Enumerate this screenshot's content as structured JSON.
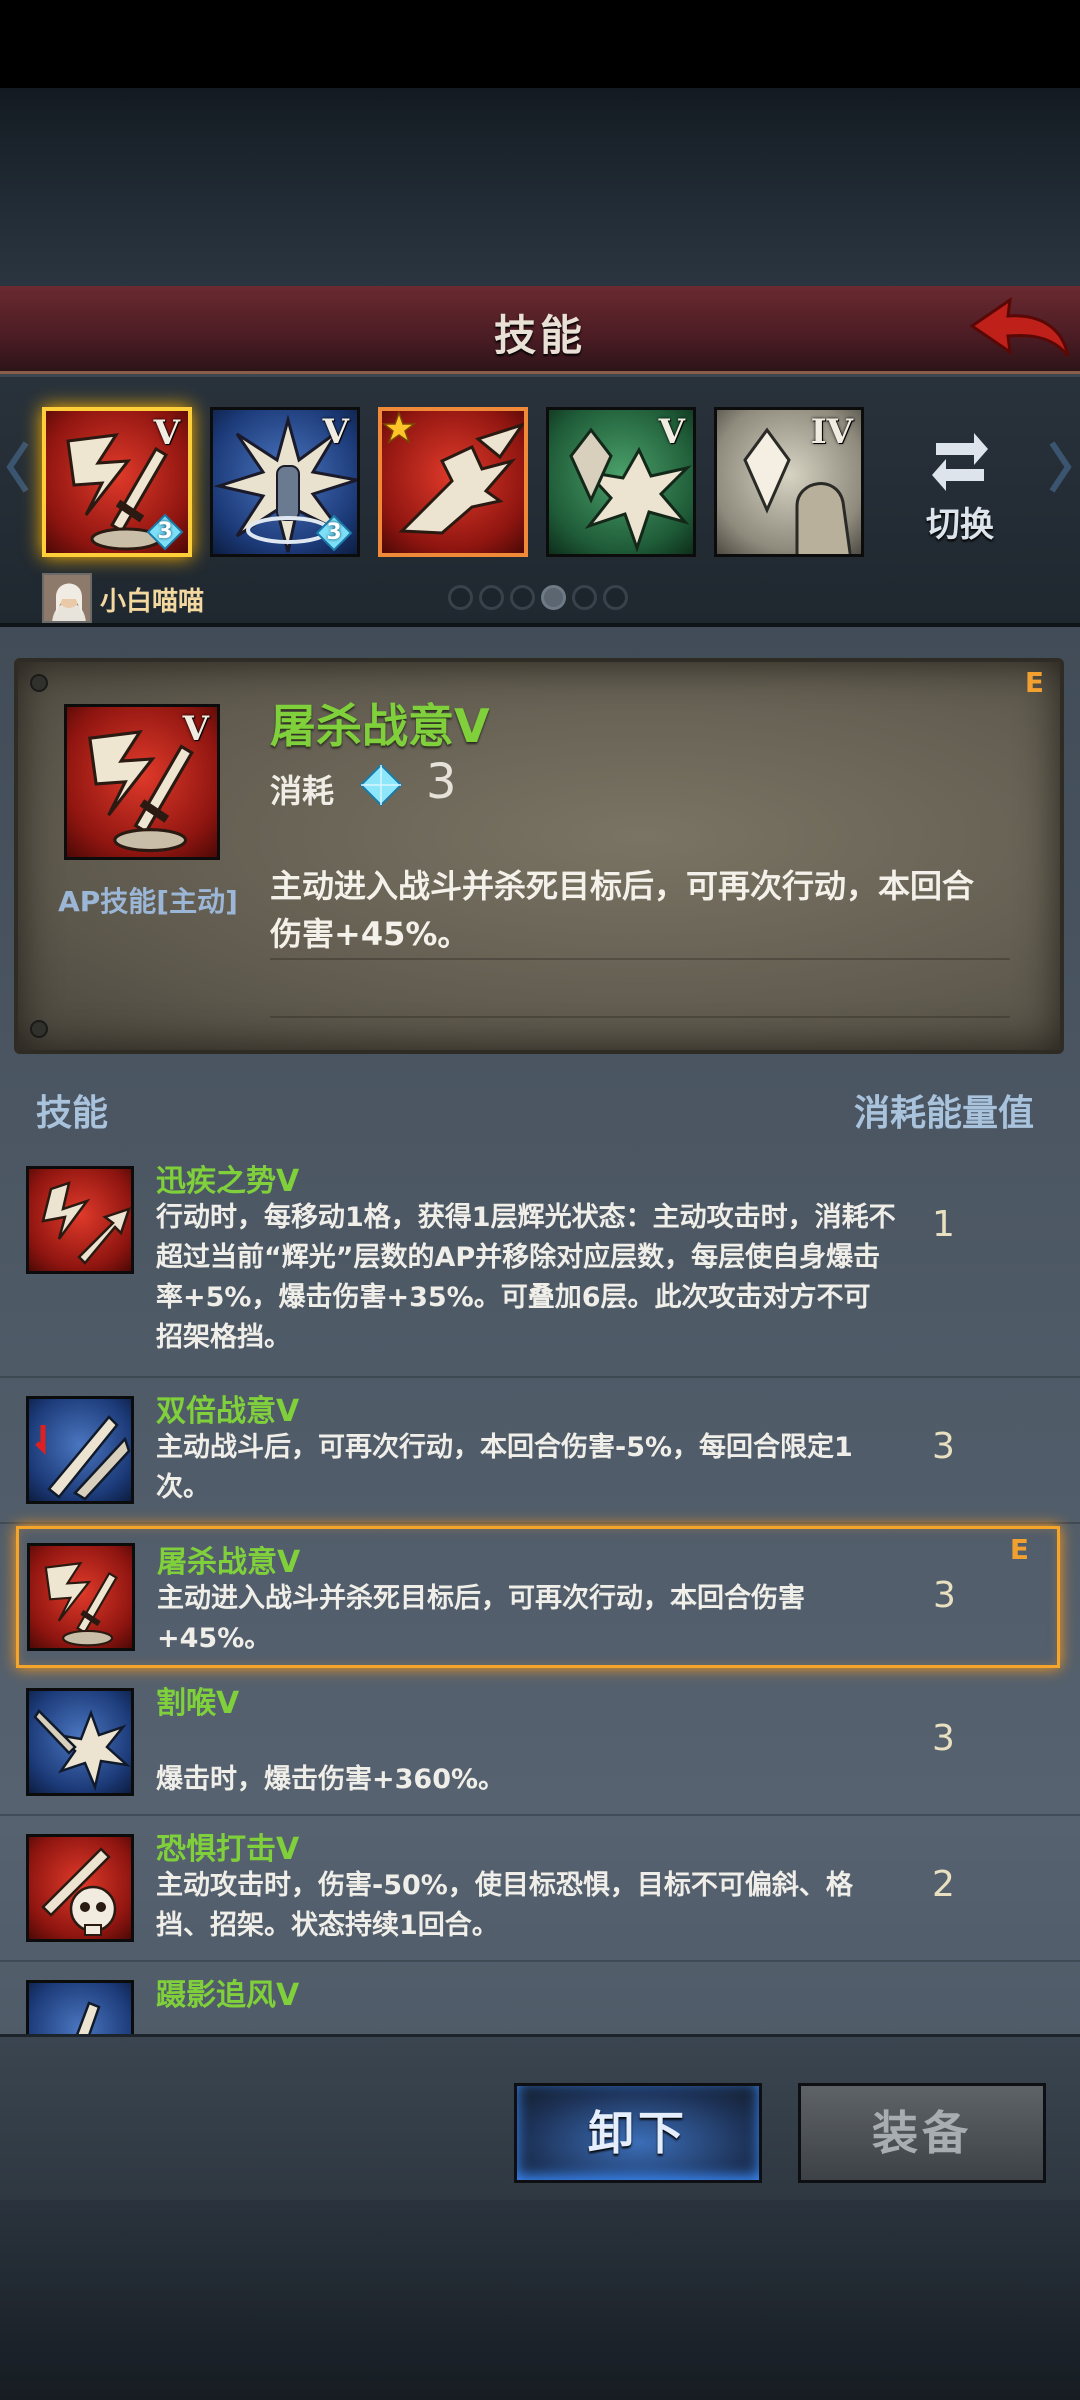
{
  "header": {
    "title": "技能"
  },
  "skillbar": {
    "slots": [
      {
        "tier": "V",
        "cost": "3",
        "color": "red",
        "icon": "slash-sword-icon",
        "selected": true
      },
      {
        "tier": "V",
        "cost": "3",
        "color": "blue",
        "icon": "burst-figure-icon"
      },
      {
        "tier": "",
        "color": "red",
        "icon": "charging-warrior-icon",
        "star": true
      },
      {
        "tier": "V",
        "color": "green",
        "icon": "crystal-burst-icon"
      },
      {
        "tier": "IV",
        "color": "grey",
        "icon": "crystal-hand-icon"
      }
    ],
    "switch_label": "切换",
    "owner_name": "小白喵喵",
    "page_dots": 6,
    "active_dot": 3
  },
  "detail": {
    "name": "屠杀战意V",
    "cost_label": "消耗",
    "cost_value": "3",
    "type_label": "AP技能[主动]",
    "description": "主动进入战斗并杀死目标后，可再次行动，本回合伤害+45%。",
    "grade": "E"
  },
  "list_header": {
    "left": "技能",
    "right": "消耗能量值"
  },
  "skills": [
    {
      "name": "迅疾之势V",
      "desc": "行动时，每移动1格，获得1层辉光状态：主动攻击时，消耗不超过当前“辉光”层数的AP并移除对应层数，每层使自身爆击率+5%，爆击伤害+35%。可叠加6层。此次攻击对方不可招架格挡。",
      "cost": "1",
      "color": "red",
      "icon": "dash-arrow-icon"
    },
    {
      "name": "双倍战意V",
      "desc": "主动战斗后，可再次行动，本回合伤害-5%，每回合限定1次。",
      "cost": "3",
      "color": "blue",
      "icon": "double-blade-icon"
    },
    {
      "name": "屠杀战意V",
      "desc": "主动进入战斗并杀死目标后，可再次行动，本回合伤害+45%。",
      "cost": "3",
      "color": "red",
      "icon": "slash-sword-icon",
      "selected": true,
      "grade": "E"
    },
    {
      "name": "割喉V",
      "desc": "爆击时，爆击伤害+360%。",
      "cost": "3",
      "color": "blue",
      "icon": "blade-burst-icon"
    },
    {
      "name": "恐惧打击V",
      "desc": "主动攻击时，伤害-50%，使目标恐惧，目标不可偏斜、格挡、招架。状态持续1回合。",
      "cost": "2",
      "color": "red",
      "icon": "skull-sword-icon"
    },
    {
      "name": "蹑影追风V",
      "desc": "",
      "cost": "",
      "color": "blue",
      "icon": "shadow-chase-icon"
    }
  ],
  "buttons": {
    "unequip": "卸下",
    "equip": "装备"
  },
  "colors": {
    "skill_name": "#7fd03a",
    "selected_border": "#f5a62a",
    "accent_gold": "#ffcf3a"
  }
}
